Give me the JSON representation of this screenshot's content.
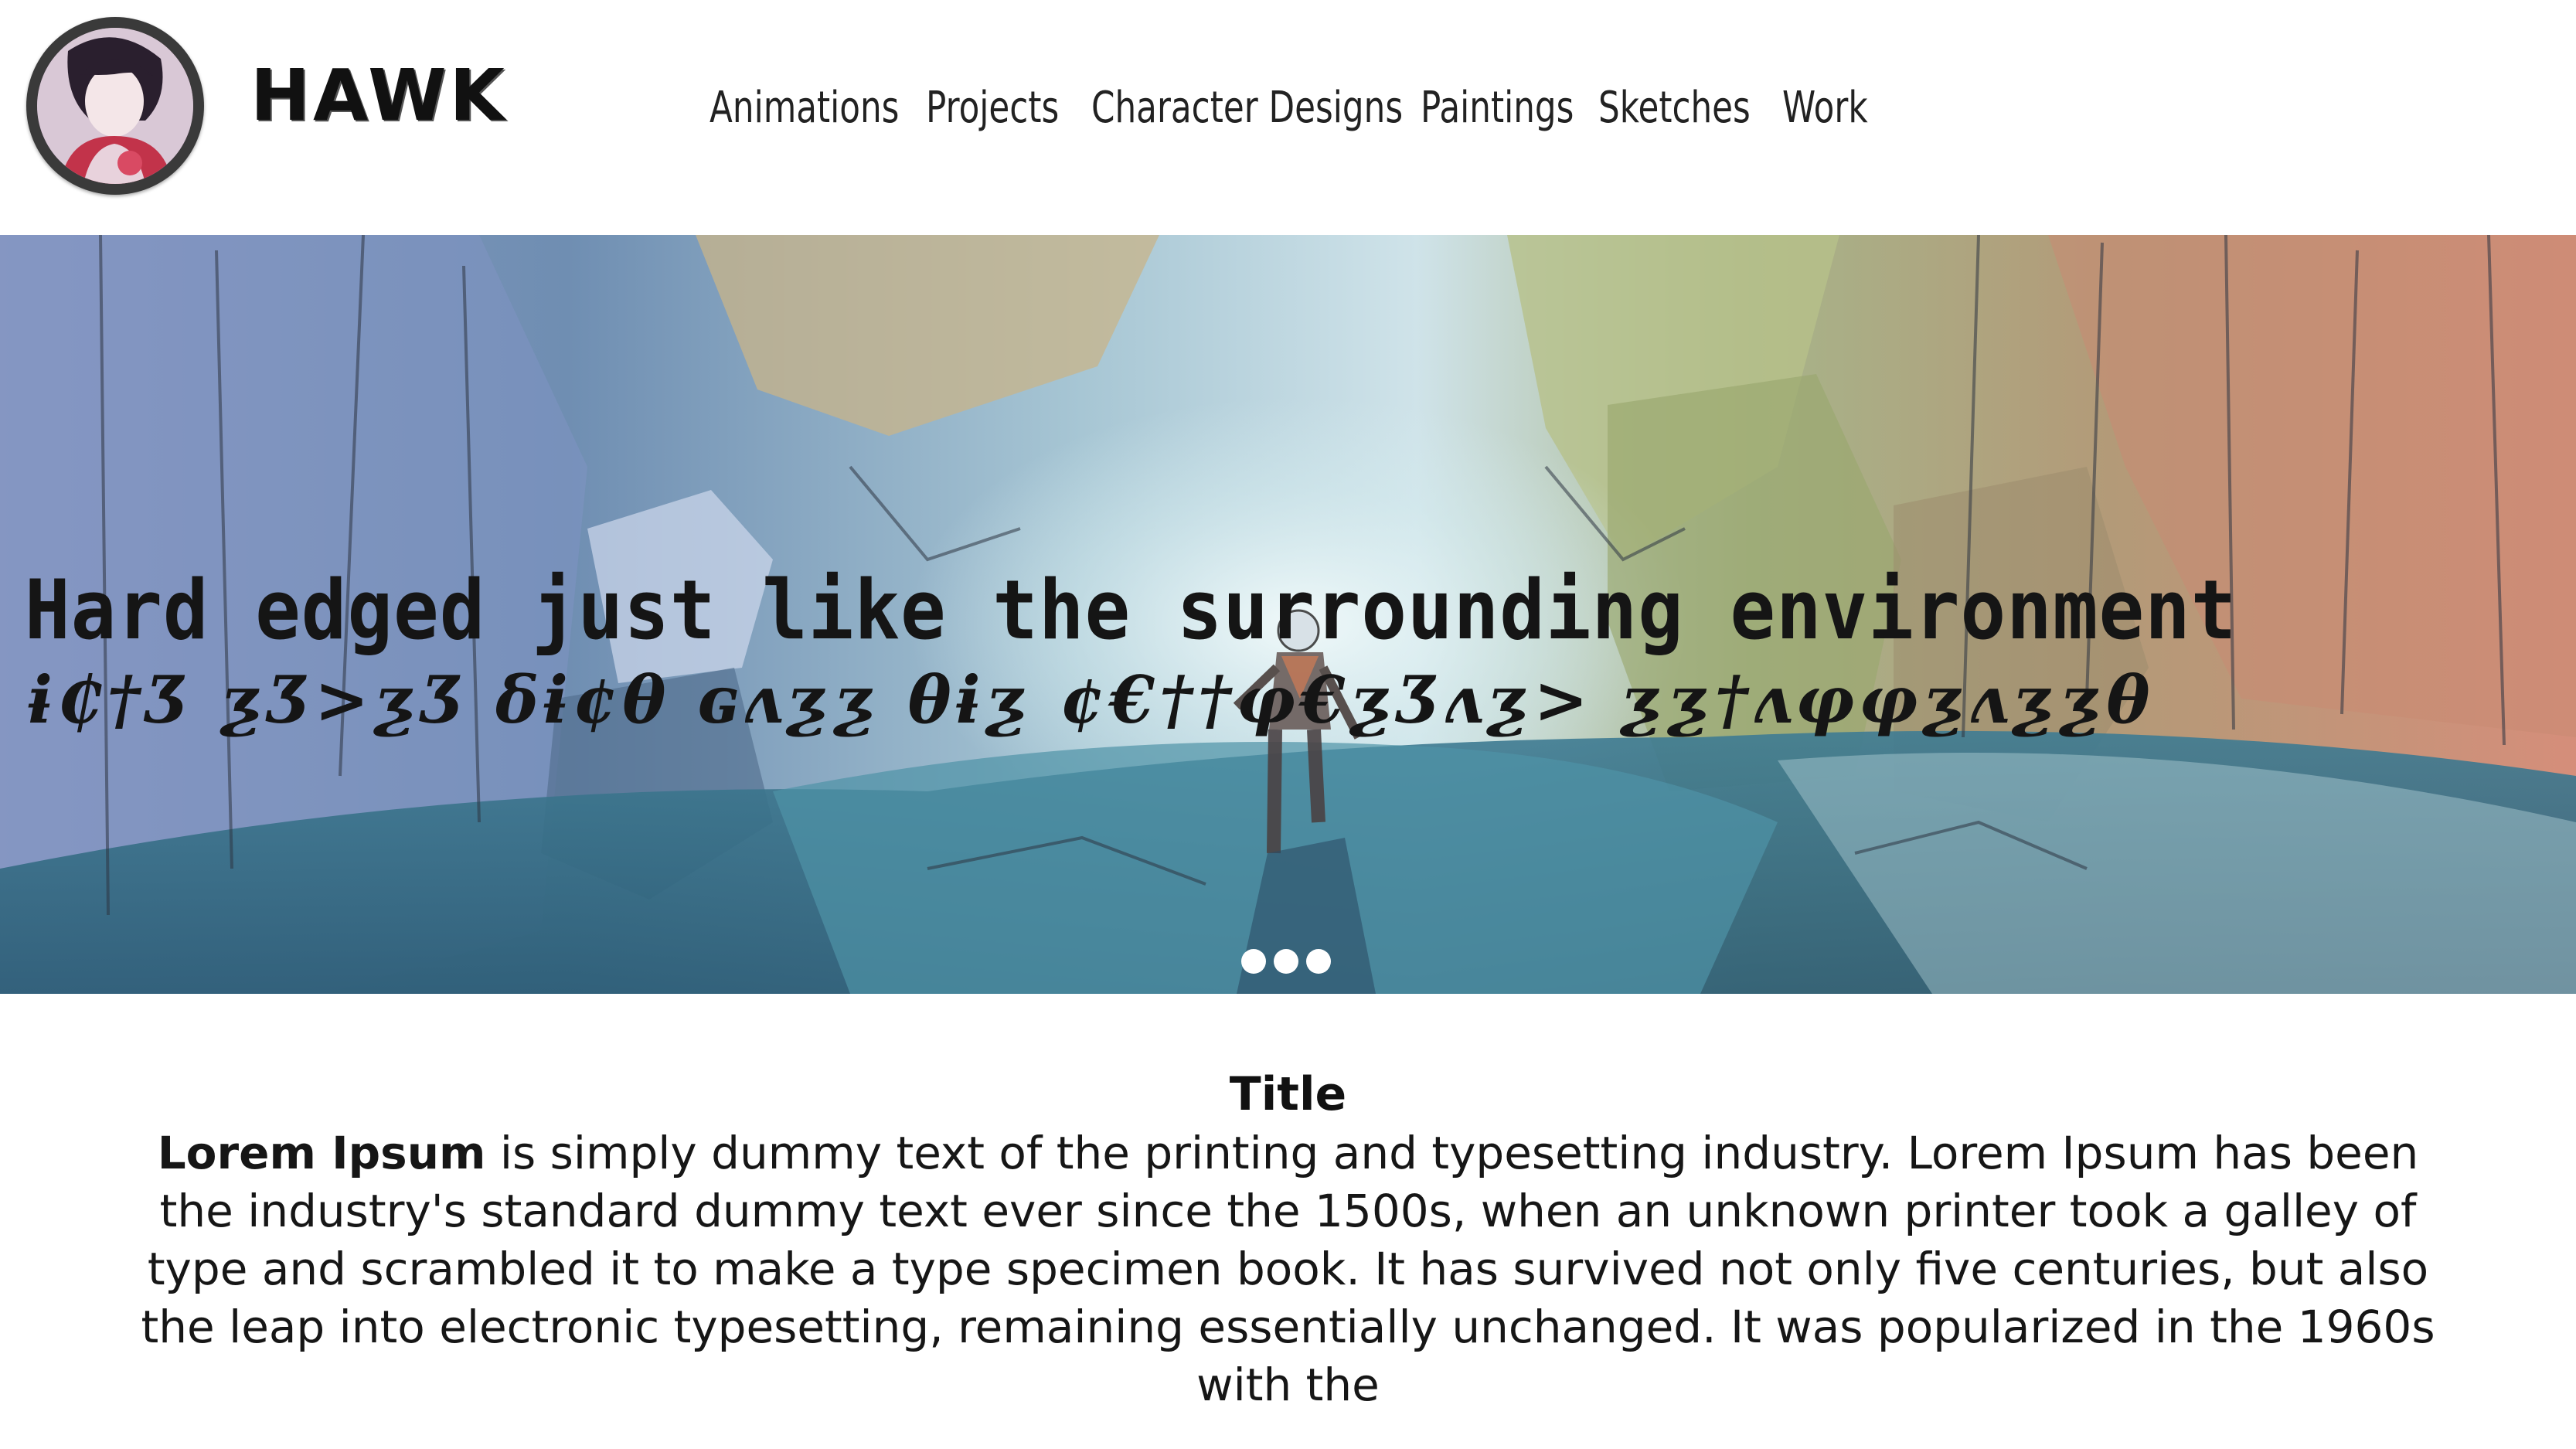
{
  "header": {
    "brand": "HAWK",
    "nav": [
      "Animations",
      "Projects",
      "Character Designs",
      "Paintings",
      "Sketches",
      "Work"
    ]
  },
  "hero": {
    "title": "Hard edged just like the surrounding environment",
    "subtitle": "ɨ₵†Ʒ ƺƷ>ƺƷ δɨ¢θ ɢʌƺƺ θɨƺ ¢€††φ€ƺƷʌƺ> ƺƺ†ʌφφƺʌƺƺθ",
    "slide_count": 3
  },
  "content": {
    "title": "Title",
    "lead": "Lorem Ipsum",
    "body": " is simply dummy text of the printing and typesetting industry. Lorem Ipsum has been the industry's standard dummy text ever since the 1500s, when an unknown printer took a galley of type and scrambled it to make a type specimen book. It has survived not only five centuries, but also the leap into electronic typesetting, remaining essentially unchanged. It was popularized in the 1960s with the"
  }
}
